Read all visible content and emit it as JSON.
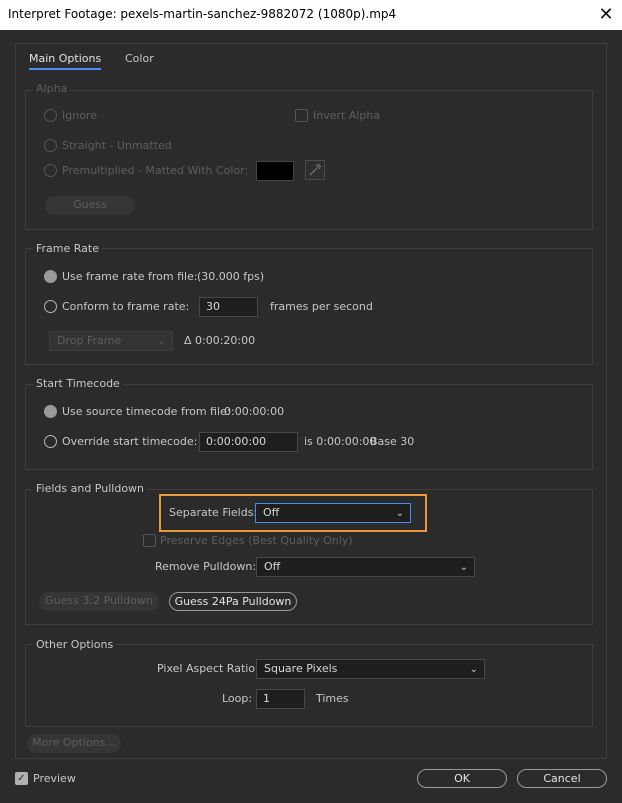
{
  "window": {
    "title": "Interpret Footage: pexels-martin-sanchez-9882072 (1080p).mp4",
    "close_glyph": "✕"
  },
  "tabs": [
    {
      "label": "Main Options",
      "active": true
    },
    {
      "label": "Color",
      "active": false
    }
  ],
  "alpha": {
    "label": "Alpha",
    "ignore": "Ignore",
    "invert": "Invert Alpha",
    "straight": "Straight - Unmatted",
    "premultiplied": "Premultiplied - Matted With Color:",
    "matte_color": "#000000",
    "guess": "Guess"
  },
  "frame_rate": {
    "label": "Frame Rate",
    "use_file": "Use frame rate from file:",
    "file_fps": "(30.000 fps)",
    "conform": "Conform to frame rate:",
    "conform_value": "30",
    "fps_suffix": "frames per second",
    "drop_frame": "Drop Frame",
    "delta": "Δ 0:00:20:00"
  },
  "start_timecode": {
    "label": "Start Timecode",
    "use_source": "Use source timecode from file:",
    "source_value": "0:00:00:00",
    "override": "Override start timecode:",
    "override_value": "0:00:00:00",
    "is_text": "is 0:00:00:00",
    "base_text": "Base 30"
  },
  "fields": {
    "label": "Fields and Pulldown",
    "separate_label": "Separate Fields:",
    "separate_value": "Off",
    "preserve": "Preserve Edges (Best Quality Only)",
    "remove_label": "Remove Pulldown:",
    "remove_value": "Off",
    "guess32": "Guess 3:2 Pulldown",
    "guess24": "Guess 24Pa Pulldown"
  },
  "other": {
    "label": "Other Options",
    "par_label": "Pixel Aspect Ratio:",
    "par_value": "Square Pixels",
    "loop_label": "Loop:",
    "loop_value": "1",
    "loop_suffix": "Times"
  },
  "footer": {
    "more": "More Options...",
    "preview": "Preview",
    "preview_checked": true,
    "ok": "OK",
    "cancel": "Cancel"
  },
  "colors": {
    "accent": "#4a8df0",
    "highlight": "#e89a3b",
    "background": "#2b2b2b"
  }
}
